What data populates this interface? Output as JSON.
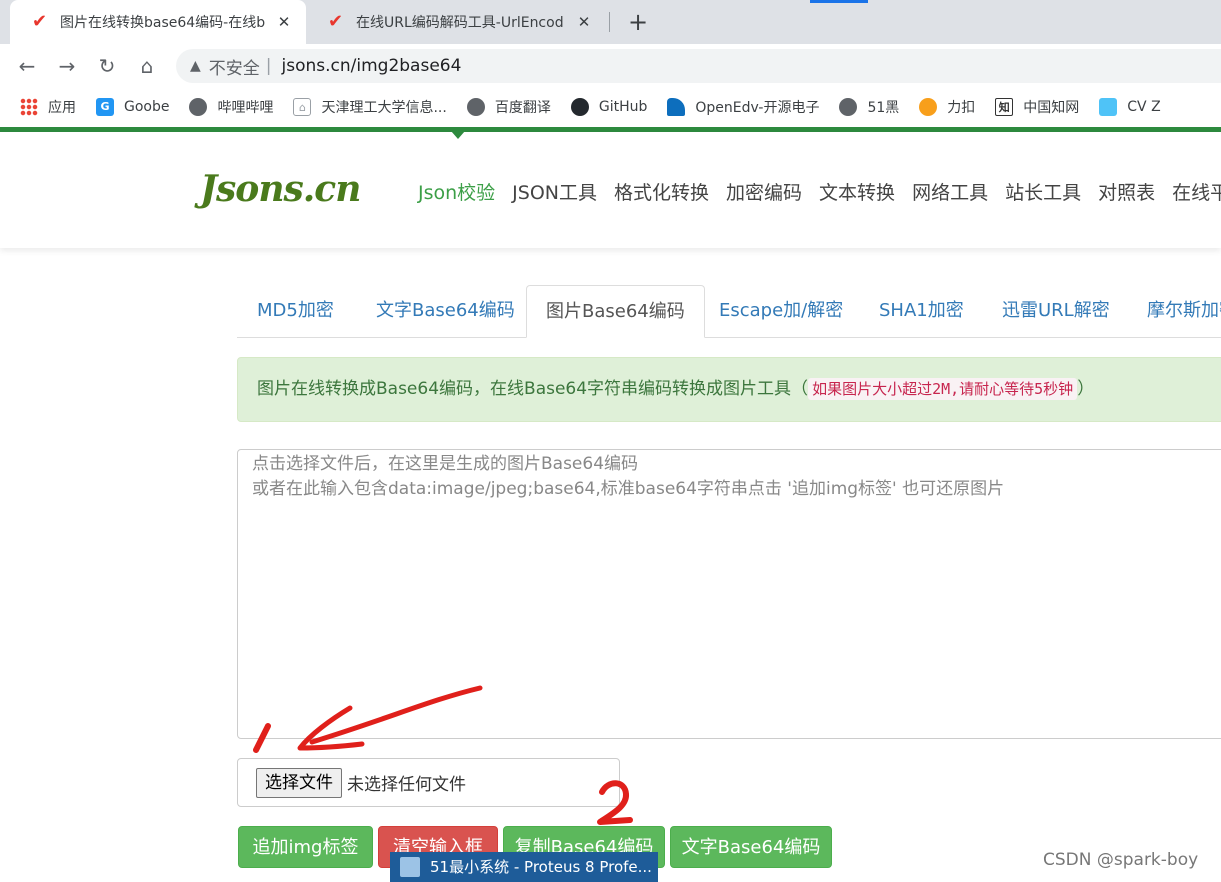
{
  "browser": {
    "tabs": [
      {
        "title": "图片在线转换base64编码-在线b",
        "active": true
      },
      {
        "title": "在线URL编码解码工具-UrlEncod",
        "active": false
      }
    ],
    "close_glyph": "✕",
    "newtab_glyph": "+",
    "nav": {
      "back": "←",
      "forward": "→",
      "reload": "↻",
      "home": "⌂"
    },
    "omnibox": {
      "warning_glyph": "▲",
      "not_secure": "不安全",
      "pipe": "|",
      "url": "jsons.cn/img2base64"
    },
    "bookmarks": [
      {
        "label": "应用",
        "icon": "apps-grid-icon"
      },
      {
        "label": "Goobe",
        "icon": "goobe-icon"
      },
      {
        "label": "哔哩哔哩",
        "icon": "globe-icon"
      },
      {
        "label": "天津理工大学信息...",
        "icon": "home-icon"
      },
      {
        "label": "百度翻译",
        "icon": "globe-icon"
      },
      {
        "label": "GitHub",
        "icon": "github-icon"
      },
      {
        "label": "OpenEdv-开源电子",
        "icon": "openedv-icon"
      },
      {
        "label": "51黑",
        "icon": "globe-icon"
      },
      {
        "label": "力扣",
        "icon": "leetcode-icon"
      },
      {
        "label": "中国知网",
        "icon": "cnki-icon"
      },
      {
        "label": "CV Z",
        "icon": "cv-icon"
      }
    ]
  },
  "site": {
    "logo": "Jsons.cn",
    "nav": [
      "Json校验",
      "JSON工具",
      "格式化转换",
      "加密编码",
      "文本转换",
      "网络工具",
      "站长工具",
      "对照表",
      "在线平"
    ],
    "tool_tabs": [
      "MD5加密",
      "文字Base64编码",
      "图片Base64编码",
      "Escape加/解密",
      "SHA1加密",
      "迅雷URL解密",
      "摩尔斯加密"
    ],
    "alert": {
      "text": "图片在线转换成Base64编码，在线Base64字符串编码转换成图片工具（",
      "code": "如果图片大小超过2M,请耐心等待5秒钟",
      "close_paren": "）"
    },
    "textarea": {
      "line1": "点击选择文件后，在这里是生成的图片Base64编码",
      "line2": "或者在此输入包含data:image/jpeg;base64,标准base64字符串点击 '追加img标签' 也可还原图片"
    },
    "file": {
      "button": "选择文件",
      "status": "未选择任何文件"
    },
    "buttons": {
      "add_img": "追加img标签",
      "clear": "清空输入框",
      "copy": "复制Base64编码",
      "text_b64": "文字Base64编码"
    }
  },
  "taskbar": {
    "label": "51最小系统 - Proteus 8 Profe..."
  },
  "watermark": "CSDN @spark-boy",
  "annotations": {
    "label_1": "1",
    "label_2": "2",
    "color": "#e0201b"
  }
}
